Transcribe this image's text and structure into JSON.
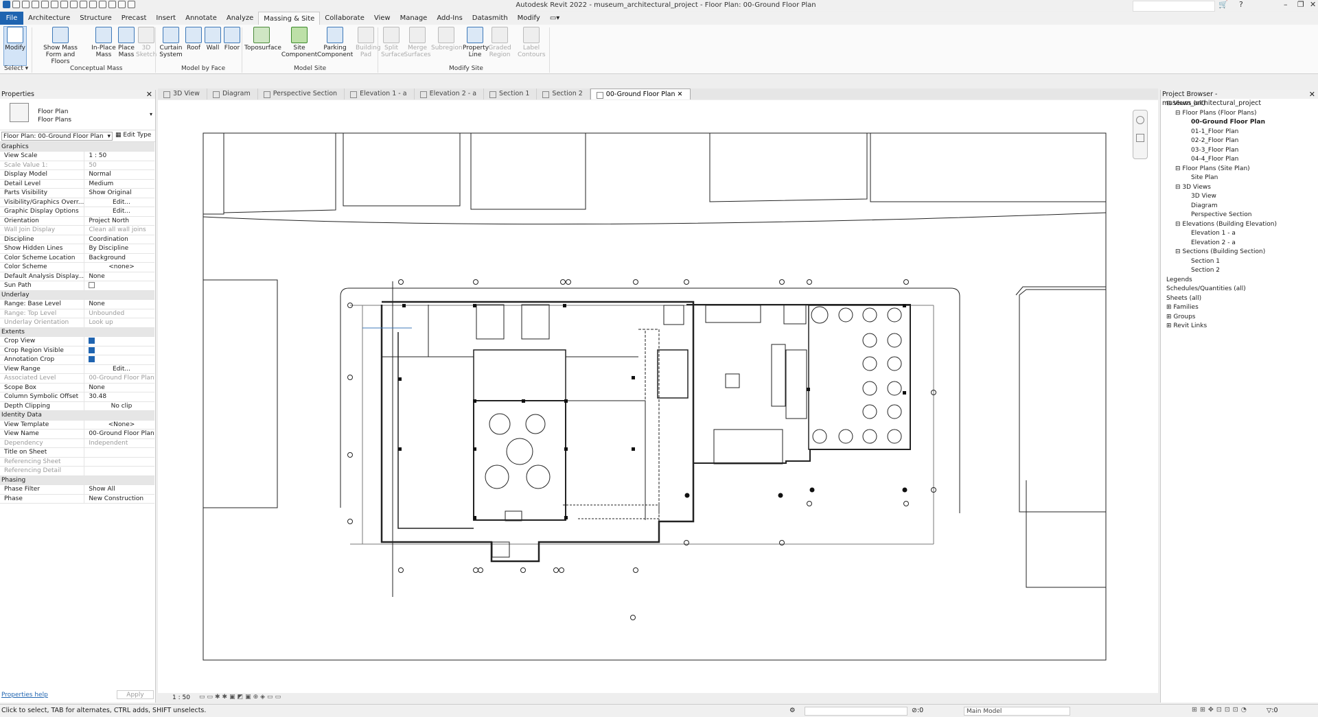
{
  "app": {
    "window_title": "Autodesk Revit 2022 - museum_architectural_project - Floor Plan: 00-Ground Floor Plan"
  },
  "ribbon_tabs": [
    "File",
    "Architecture",
    "Structure",
    "Precast",
    "Insert",
    "Annotate",
    "Analyze",
    "Massing & Site",
    "Collaborate",
    "View",
    "Manage",
    "Add-Ins",
    "Datasmith",
    "Modify"
  ],
  "ribbon": {
    "buttons": [
      {
        "label": "Modify",
        "icon": "cursor-icon"
      },
      {
        "label": "Show Mass Form and Floors",
        "icon": "mass-floors-icon"
      },
      {
        "label": "In-Place Mass",
        "icon": "inplace-mass-icon"
      },
      {
        "label": "Place Mass",
        "icon": "place-mass-icon"
      },
      {
        "label": "3D Sketch",
        "icon": "sketch-3d-icon"
      },
      {
        "label": "Curtain System",
        "icon": "curtain-system-icon"
      },
      {
        "label": "Roof",
        "icon": "roof-icon"
      },
      {
        "label": "Wall",
        "icon": "wall-icon"
      },
      {
        "label": "Floor",
        "icon": "floor-icon"
      },
      {
        "label": "Toposurface",
        "icon": "toposurface-icon"
      },
      {
        "label": "Site Component",
        "icon": "tree-icon"
      },
      {
        "label": "Parking Component",
        "icon": "parking-icon"
      },
      {
        "label": "Building Pad",
        "icon": "building-pad-icon"
      },
      {
        "label": "Split Surface",
        "icon": "split-surface-icon"
      },
      {
        "label": "Merge Surfaces",
        "icon": "merge-surfaces-icon"
      },
      {
        "label": "Subregion",
        "icon": "subregion-icon"
      },
      {
        "label": "Property Line",
        "icon": "property-line-icon"
      },
      {
        "label": "Graded Region",
        "icon": "graded-region-icon"
      },
      {
        "label": "Label Contours",
        "icon": "label-contours-icon"
      }
    ],
    "panels": [
      "Select",
      "Conceptual Mass",
      "Model by Face",
      "Model Site",
      "Modify Site"
    ]
  },
  "properties": {
    "header": "Properties",
    "type_name": "Floor Plan",
    "type_sub": "Floor Plans",
    "instance_selector": "Floor Plan: 00-Ground Floor Plan",
    "edit_type": "Edit Type",
    "groups": [
      {
        "name": "Graphics",
        "rows": [
          [
            "View Scale",
            "1 : 50"
          ],
          [
            "Scale Value    1:",
            "50"
          ],
          [
            "Display Model",
            "Normal"
          ],
          [
            "Detail Level",
            "Medium"
          ],
          [
            "Parts Visibility",
            "Show Original"
          ],
          [
            "Visibility/Graphics Overr...",
            "Edit..."
          ],
          [
            "Graphic Display Options",
            "Edit..."
          ],
          [
            "Orientation",
            "Project North"
          ],
          [
            "Wall Join Display",
            "Clean all wall joins"
          ],
          [
            "Discipline",
            "Coordination"
          ],
          [
            "Show Hidden Lines",
            "By Discipline"
          ],
          [
            "Color Scheme Location",
            "Background"
          ],
          [
            "Color Scheme",
            "<none>"
          ],
          [
            "Default Analysis Display...",
            "None"
          ],
          [
            "Sun Path",
            ""
          ]
        ]
      },
      {
        "name": "Underlay",
        "rows": [
          [
            "Range: Base Level",
            "None"
          ],
          [
            "Range: Top Level",
            "Unbounded"
          ],
          [
            "Underlay Orientation",
            "Look up"
          ]
        ]
      },
      {
        "name": "Extents",
        "rows": [
          [
            "Crop View",
            ""
          ],
          [
            "Crop Region Visible",
            ""
          ],
          [
            "Annotation Crop",
            ""
          ],
          [
            "View Range",
            "Edit..."
          ],
          [
            "Associated Level",
            "00-Ground Floor Plan"
          ],
          [
            "Scope Box",
            "None"
          ],
          [
            "Column Symbolic Offset",
            "30.48"
          ],
          [
            "Depth Clipping",
            "No clip"
          ]
        ]
      },
      {
        "name": "Identity Data",
        "rows": [
          [
            "View Template",
            "<None>"
          ],
          [
            "View Name",
            "00-Ground Floor Plan"
          ],
          [
            "Dependency",
            "Independent"
          ],
          [
            "Title on Sheet",
            ""
          ],
          [
            "Referencing Sheet",
            ""
          ],
          [
            "Referencing Detail",
            ""
          ]
        ]
      },
      {
        "name": "Phasing",
        "rows": [
          [
            "Phase Filter",
            "Show All"
          ],
          [
            "Phase",
            "New Construction"
          ]
        ]
      }
    ],
    "help": "Properties help",
    "apply": "Apply"
  },
  "view_tabs": [
    "3D View",
    "Diagram",
    "Perspective Section",
    "Elevation 1 - a",
    "Elevation 2 - a",
    "Section 1",
    "Section 2",
    "00-Ground Floor Plan"
  ],
  "project_browser": {
    "header": "Project Browser - museum_architectural_project",
    "items": [
      "Views (all)",
      "Floor Plans (Floor Plans)",
      "00-Ground Floor Plan",
      "01-1_Floor Plan",
      "02-2_Floor Plan",
      "03-3_Floor Plan",
      "04-4_Floor Plan",
      "Floor Plans (Site Plan)",
      "Site Plan",
      "3D Views",
      "3D View",
      "Diagram",
      "Perspective Section",
      "Elevations (Building Elevation)",
      "Elevation 1 - a",
      "Elevation 2 - a",
      "Sections (Building Section)",
      "Section 1",
      "Section 2",
      "Legends",
      "Schedules/Quantities (all)",
      "Sheets (all)",
      "Families",
      "Groups",
      "Revit Links"
    ]
  },
  "view_control": {
    "scale": "1 : 50"
  },
  "status": {
    "message": "Click to select, TAB for alternates, CTRL adds, SHIFT unselects.",
    "workset": ":0",
    "model": "Main Model",
    "filter": ":0"
  }
}
